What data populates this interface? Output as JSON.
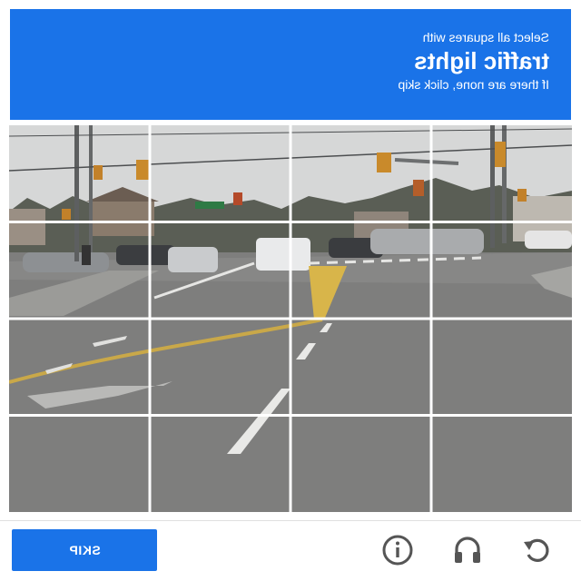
{
  "header": {
    "instruction": "Select all squares with",
    "target": "traffic lights",
    "hint": "If there are none, click skip"
  },
  "grid": {
    "rows": 4,
    "columns": 4
  },
  "footer": {
    "skip_label": "SKIP",
    "icons": [
      "info-icon",
      "headphones-icon",
      "reload-icon"
    ]
  },
  "colors": {
    "accent": "#1a73e8",
    "icon": "#555555"
  }
}
